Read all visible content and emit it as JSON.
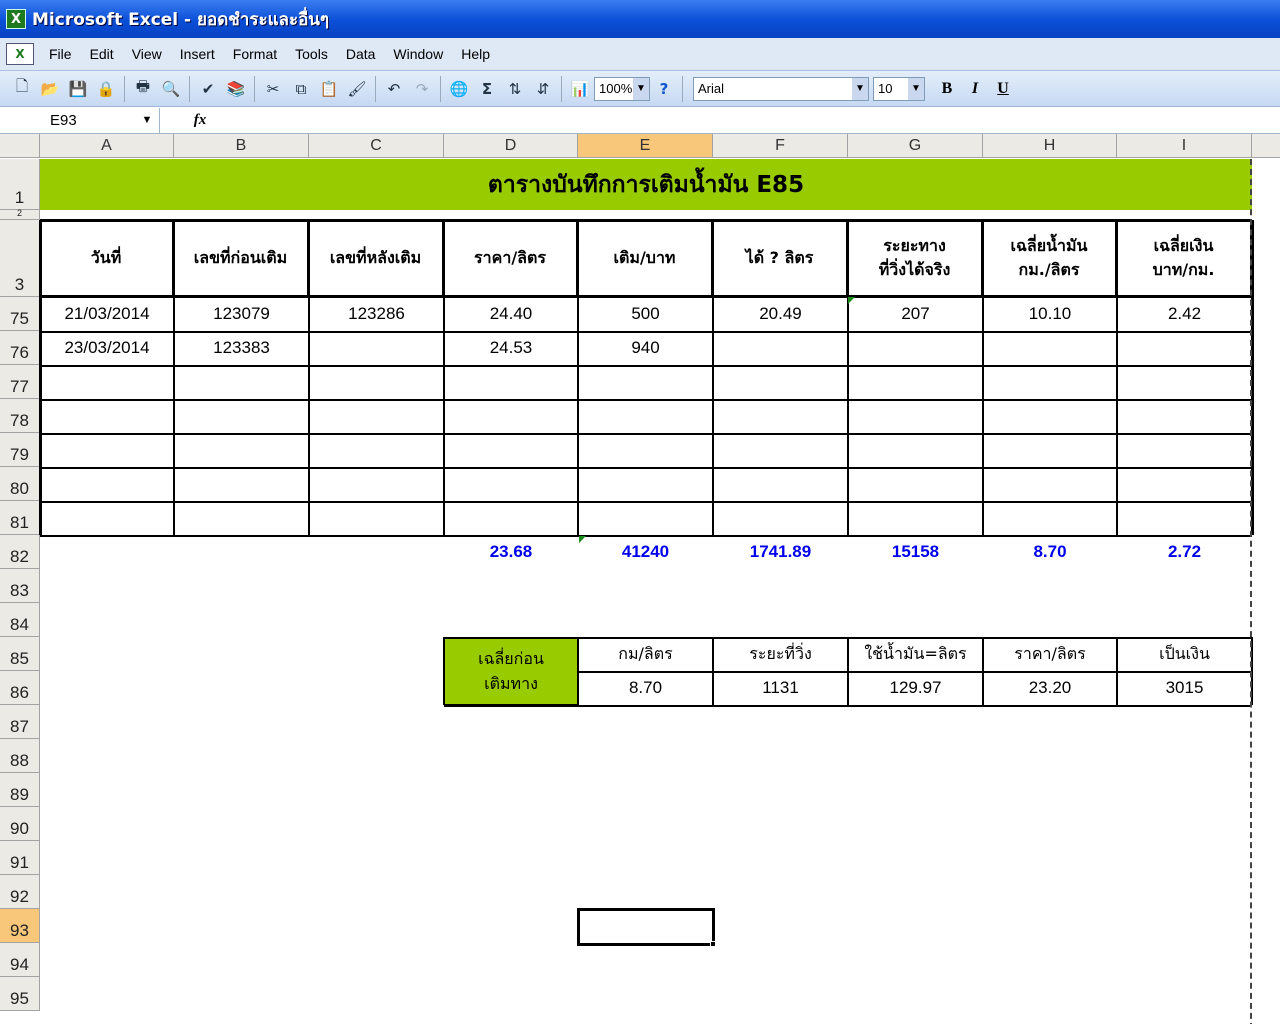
{
  "window": {
    "title": "Microsoft Excel - ยอดชำระและอื่นๆ",
    "app_icon": "excel-icon"
  },
  "menu": [
    "File",
    "Edit",
    "View",
    "Insert",
    "Format",
    "Tools",
    "Data",
    "Window",
    "Help"
  ],
  "toolbar": {
    "zoom": "100%",
    "font": "Arial",
    "font_size": "10",
    "bold": "B",
    "italic": "I",
    "underline": "U",
    "icons": [
      "new-icon",
      "open-icon",
      "save-icon",
      "permission-icon",
      "print-icon",
      "print-preview-icon",
      "spelling-icon",
      "research-icon",
      "cut-icon",
      "copy-icon",
      "paste-icon",
      "format-painter-icon",
      "undo-icon",
      "redo-icon",
      "hyperlink-icon",
      "autosum-icon",
      "sort-ascending-icon",
      "sort-descending-icon",
      "chart-wizard-icon",
      "help-icon"
    ]
  },
  "formula_bar": {
    "name_box": "E93",
    "fx": "fx",
    "content": ""
  },
  "columns": [
    "A",
    "B",
    "C",
    "D",
    "E",
    "F",
    "G",
    "H",
    "I"
  ],
  "selected_column": "E",
  "rows": [
    "1",
    "2",
    "3",
    "75",
    "76",
    "77",
    "78",
    "79",
    "80",
    "81",
    "82",
    "83",
    "84",
    "85",
    "86",
    "87",
    "88",
    "89",
    "90",
    "91",
    "92",
    "93",
    "94",
    "95"
  ],
  "selected_row": "93",
  "sheet": {
    "title": "ตารางบันทึกการเติมน้ำมัน E85",
    "title_color": "#99cc00",
    "headers": [
      "วันที่",
      "เลขที่ก่อนเติม",
      "เลขที่หลังเติม",
      "ราคา/ลิตร",
      "เติม/บาท",
      "ได้ ? ลิตร",
      "ระยะทาง\nที่วิ่งได้จริง",
      "เฉลี่ยน้ำมัน\nกม./ลิตร",
      "เฉลี่ยเงิน\nบาท/กม."
    ],
    "data_rows": [
      [
        "21/03/2014",
        "123079",
        "123286",
        "24.40",
        "500",
        "20.49",
        "207",
        "10.10",
        "2.42"
      ],
      [
        "23/03/2014",
        "123383",
        "",
        "24.53",
        "940",
        "",
        "",
        "",
        ""
      ],
      [
        "",
        "",
        "",
        "",
        "",
        "",
        "",
        "",
        ""
      ],
      [
        "",
        "",
        "",
        "",
        "",
        "",
        "",
        "",
        ""
      ],
      [
        "",
        "",
        "",
        "",
        "",
        "",
        "",
        "",
        ""
      ],
      [
        "",
        "",
        "",
        "",
        "",
        "",
        "",
        "",
        ""
      ],
      [
        "",
        "",
        "",
        "",
        "",
        "",
        "",
        "",
        ""
      ]
    ],
    "totals": [
      "23.68",
      "41240",
      "1741.89",
      "15158",
      "8.70",
      "2.72"
    ],
    "totals_color": "#0000ee"
  },
  "summary": {
    "label": "เฉลี่ยก่อน\nเติมทาง",
    "headers": [
      "กม/ลิตร",
      "ระยะที่วิ่ง",
      "ใช้น้ำมัน=ลิตร",
      "ราคา/ลิตร",
      "เป็นเงิน"
    ],
    "values": [
      "8.70",
      "1131",
      "129.97",
      "23.20",
      "3015"
    ]
  }
}
